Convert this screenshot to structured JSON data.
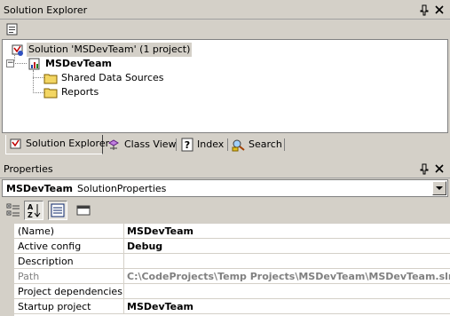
{
  "solution_explorer": {
    "title": "Solution Explorer",
    "tree": {
      "solution_label": "Solution 'MSDevTeam' (1 project)",
      "project_label": "MSDevTeam",
      "folders": [
        "Shared Data Sources",
        "Reports"
      ]
    }
  },
  "tabs": [
    {
      "label": "Solution Explorer",
      "icon": "solution-explorer-icon",
      "active": true
    },
    {
      "label": "Class View",
      "icon": "class-view-icon",
      "active": false
    },
    {
      "label": "Index",
      "icon": "help-index-icon",
      "active": false
    },
    {
      "label": "Search",
      "icon": "search-icon",
      "active": false
    }
  ],
  "properties": {
    "title": "Properties",
    "object_name": "MSDevTeam",
    "object_type": "SolutionProperties",
    "rows": [
      {
        "name": "(Name)",
        "value": "MSDevTeam",
        "readonly": false
      },
      {
        "name": "Active config",
        "value": "Debug",
        "readonly": false
      },
      {
        "name": "Description",
        "value": "",
        "readonly": false
      },
      {
        "name": "Path",
        "value": "C:\\CodeProjects\\Temp Projects\\MSDevTeam\\MSDevTeam.sln",
        "readonly": true
      },
      {
        "name": "Project dependencies",
        "value": "",
        "readonly": false
      },
      {
        "name": "Startup project",
        "value": "MSDevTeam",
        "readonly": false
      }
    ]
  },
  "colors": {
    "panel": "#d4d0c8",
    "folder": "#f3d663",
    "selected_tab_accent": "#0a246a"
  }
}
